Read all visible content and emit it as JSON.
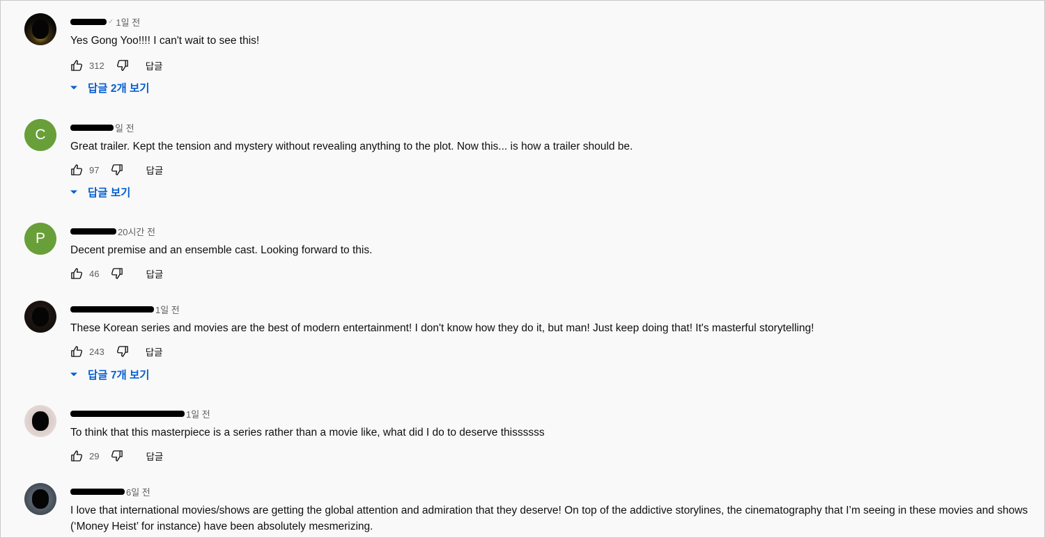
{
  "ui": {
    "reply_label": "답글"
  },
  "comments": [
    {
      "author_redacted": true,
      "timestamp": "1일 전",
      "text": "Yes Gong Yoo!!!! I can't wait to see this!",
      "likes": "312",
      "view_replies": "답글 2개 보기",
      "avatar": "photo-gold"
    },
    {
      "author_redacted": true,
      "timestamp": "일 전",
      "text": "Great trailer. Kept the tension and mystery without revealing anything to the plot. Now this... is how a trailer should be.",
      "likes": "97",
      "view_replies": "답글 보기",
      "avatar_letter": "C"
    },
    {
      "author_redacted": true,
      "timestamp": "20시간 전",
      "text": "Decent premise and an ensemble cast. Looking forward to this.",
      "likes": "46",
      "avatar_letter": "P"
    },
    {
      "author_redacted": true,
      "timestamp": "1일 전",
      "text": "These Korean series and movies are the best of modern entertainment! I don't know how they do it, but man! Just keep doing that! It's masterful storytelling!",
      "likes": "243",
      "view_replies": "답글 7개 보기",
      "avatar": "photo-dark"
    },
    {
      "author_redacted": true,
      "timestamp": "1일 전",
      "text": "To think that this masterpiece is a series rather than a movie like, what did I do to deserve thissssss",
      "likes": "29",
      "avatar": "photo-light"
    },
    {
      "author_redacted": true,
      "timestamp": "6일 전",
      "text": "I love that international movies/shows are getting the global attention and admiration that they deserve! On top of the addictive storylines, the cinematography that I’m seeing in these movies and shows (‘Money Heist’ for instance) have been absolutely mesmerizing.",
      "avatar": "photo-gray"
    }
  ],
  "colors": {
    "background": "#f9f9f9",
    "link_blue": "#065fd4",
    "avatar_green": "#689f38",
    "secondary_text": "#606060"
  },
  "icons": [
    "like-icon",
    "dislike-icon",
    "chevron-down-icon"
  ]
}
